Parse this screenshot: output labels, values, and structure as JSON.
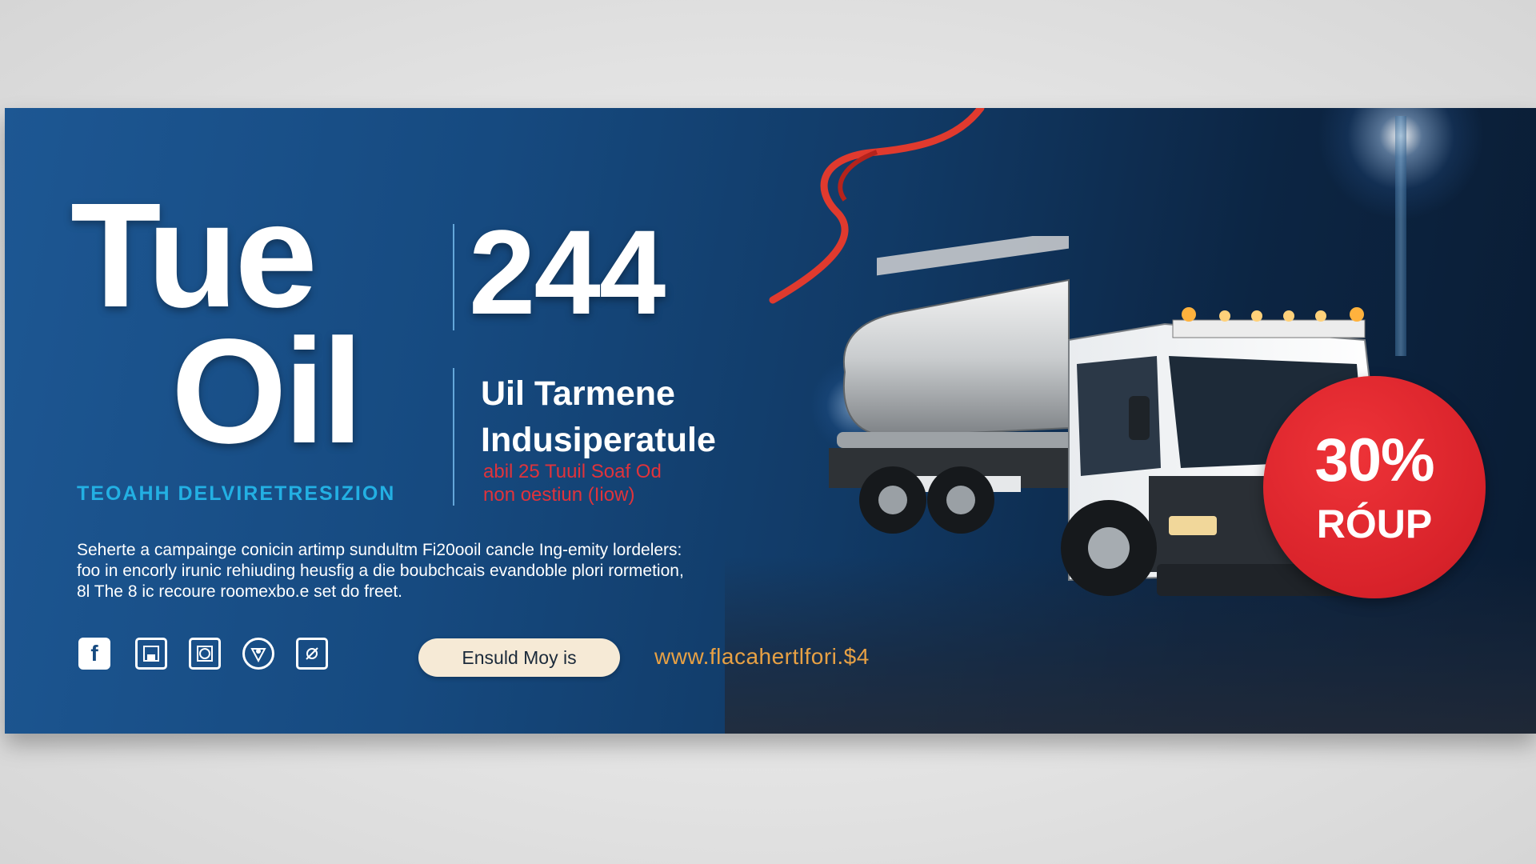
{
  "banner": {
    "title_line1": "Tue",
    "title_number": "244",
    "title_line2": "Oil",
    "tagline": "TEOAHH DELVIRETRESIZION",
    "subheading_line1": "Uil Tarmene",
    "subheading_line2": "Indusiperatule",
    "red_line1": "abil 25 Tuuil Soaf Od",
    "red_line2": "non oestiun (Iiow)",
    "description": [
      "Seherte a campainge conicin artimp sundultm Fi20ooil cancle Ing-emity lordelers:",
      "foo in encorly irunic rehiuding heusfig a die boubchcais evandoble plori rormetion,",
      "8l The 8 ic recoure roomexbo.e set do freet."
    ],
    "cta_label": "Ensuld Moy is",
    "url": "www.flacahertlfori.$4",
    "badge_percent": "30%",
    "badge_label": "RÓUP",
    "social_icons": [
      "facebook-icon",
      "save-icon",
      "image-icon",
      "badge-icon",
      "camera-icon"
    ]
  },
  "colors": {
    "banner_blue": "#164a80",
    "tagline_cyan": "#23b0e3",
    "accent_red": "#d8222a",
    "url_orange": "#e8a144",
    "cta_cream": "#f6ead6"
  }
}
